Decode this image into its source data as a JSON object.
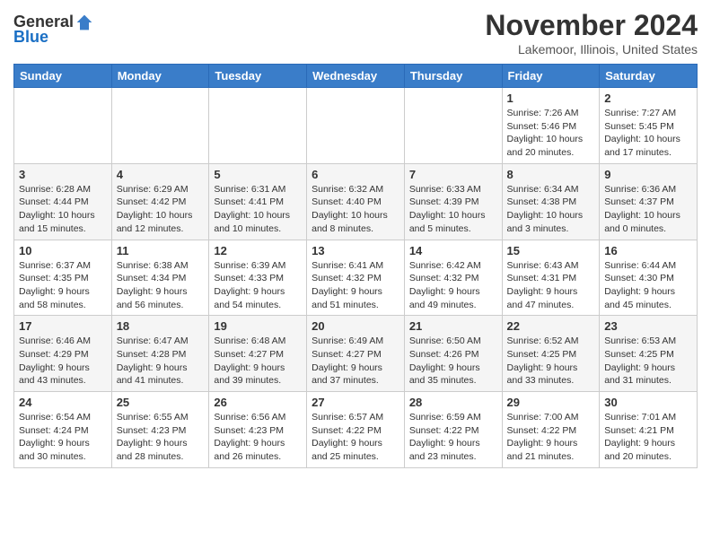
{
  "header": {
    "logo_general": "General",
    "logo_blue": "Blue",
    "month_title": "November 2024",
    "location": "Lakemoor, Illinois, United States"
  },
  "weekdays": [
    "Sunday",
    "Monday",
    "Tuesday",
    "Wednesday",
    "Thursday",
    "Friday",
    "Saturday"
  ],
  "weeks": [
    [
      {
        "day": "",
        "info": ""
      },
      {
        "day": "",
        "info": ""
      },
      {
        "day": "",
        "info": ""
      },
      {
        "day": "",
        "info": ""
      },
      {
        "day": "",
        "info": ""
      },
      {
        "day": "1",
        "info": "Sunrise: 7:26 AM\nSunset: 5:46 PM\nDaylight: 10 hours\nand 20 minutes."
      },
      {
        "day": "2",
        "info": "Sunrise: 7:27 AM\nSunset: 5:45 PM\nDaylight: 10 hours\nand 17 minutes."
      }
    ],
    [
      {
        "day": "3",
        "info": "Sunrise: 6:28 AM\nSunset: 4:44 PM\nDaylight: 10 hours\nand 15 minutes."
      },
      {
        "day": "4",
        "info": "Sunrise: 6:29 AM\nSunset: 4:42 PM\nDaylight: 10 hours\nand 12 minutes."
      },
      {
        "day": "5",
        "info": "Sunrise: 6:31 AM\nSunset: 4:41 PM\nDaylight: 10 hours\nand 10 minutes."
      },
      {
        "day": "6",
        "info": "Sunrise: 6:32 AM\nSunset: 4:40 PM\nDaylight: 10 hours\nand 8 minutes."
      },
      {
        "day": "7",
        "info": "Sunrise: 6:33 AM\nSunset: 4:39 PM\nDaylight: 10 hours\nand 5 minutes."
      },
      {
        "day": "8",
        "info": "Sunrise: 6:34 AM\nSunset: 4:38 PM\nDaylight: 10 hours\nand 3 minutes."
      },
      {
        "day": "9",
        "info": "Sunrise: 6:36 AM\nSunset: 4:37 PM\nDaylight: 10 hours\nand 0 minutes."
      }
    ],
    [
      {
        "day": "10",
        "info": "Sunrise: 6:37 AM\nSunset: 4:35 PM\nDaylight: 9 hours\nand 58 minutes."
      },
      {
        "day": "11",
        "info": "Sunrise: 6:38 AM\nSunset: 4:34 PM\nDaylight: 9 hours\nand 56 minutes."
      },
      {
        "day": "12",
        "info": "Sunrise: 6:39 AM\nSunset: 4:33 PM\nDaylight: 9 hours\nand 54 minutes."
      },
      {
        "day": "13",
        "info": "Sunrise: 6:41 AM\nSunset: 4:32 PM\nDaylight: 9 hours\nand 51 minutes."
      },
      {
        "day": "14",
        "info": "Sunrise: 6:42 AM\nSunset: 4:32 PM\nDaylight: 9 hours\nand 49 minutes."
      },
      {
        "day": "15",
        "info": "Sunrise: 6:43 AM\nSunset: 4:31 PM\nDaylight: 9 hours\nand 47 minutes."
      },
      {
        "day": "16",
        "info": "Sunrise: 6:44 AM\nSunset: 4:30 PM\nDaylight: 9 hours\nand 45 minutes."
      }
    ],
    [
      {
        "day": "17",
        "info": "Sunrise: 6:46 AM\nSunset: 4:29 PM\nDaylight: 9 hours\nand 43 minutes."
      },
      {
        "day": "18",
        "info": "Sunrise: 6:47 AM\nSunset: 4:28 PM\nDaylight: 9 hours\nand 41 minutes."
      },
      {
        "day": "19",
        "info": "Sunrise: 6:48 AM\nSunset: 4:27 PM\nDaylight: 9 hours\nand 39 minutes."
      },
      {
        "day": "20",
        "info": "Sunrise: 6:49 AM\nSunset: 4:27 PM\nDaylight: 9 hours\nand 37 minutes."
      },
      {
        "day": "21",
        "info": "Sunrise: 6:50 AM\nSunset: 4:26 PM\nDaylight: 9 hours\nand 35 minutes."
      },
      {
        "day": "22",
        "info": "Sunrise: 6:52 AM\nSunset: 4:25 PM\nDaylight: 9 hours\nand 33 minutes."
      },
      {
        "day": "23",
        "info": "Sunrise: 6:53 AM\nSunset: 4:25 PM\nDaylight: 9 hours\nand 31 minutes."
      }
    ],
    [
      {
        "day": "24",
        "info": "Sunrise: 6:54 AM\nSunset: 4:24 PM\nDaylight: 9 hours\nand 30 minutes."
      },
      {
        "day": "25",
        "info": "Sunrise: 6:55 AM\nSunset: 4:23 PM\nDaylight: 9 hours\nand 28 minutes."
      },
      {
        "day": "26",
        "info": "Sunrise: 6:56 AM\nSunset: 4:23 PM\nDaylight: 9 hours\nand 26 minutes."
      },
      {
        "day": "27",
        "info": "Sunrise: 6:57 AM\nSunset: 4:22 PM\nDaylight: 9 hours\nand 25 minutes."
      },
      {
        "day": "28",
        "info": "Sunrise: 6:59 AM\nSunset: 4:22 PM\nDaylight: 9 hours\nand 23 minutes."
      },
      {
        "day": "29",
        "info": "Sunrise: 7:00 AM\nSunset: 4:22 PM\nDaylight: 9 hours\nand 21 minutes."
      },
      {
        "day": "30",
        "info": "Sunrise: 7:01 AM\nSunset: 4:21 PM\nDaylight: 9 hours\nand 20 minutes."
      }
    ]
  ]
}
